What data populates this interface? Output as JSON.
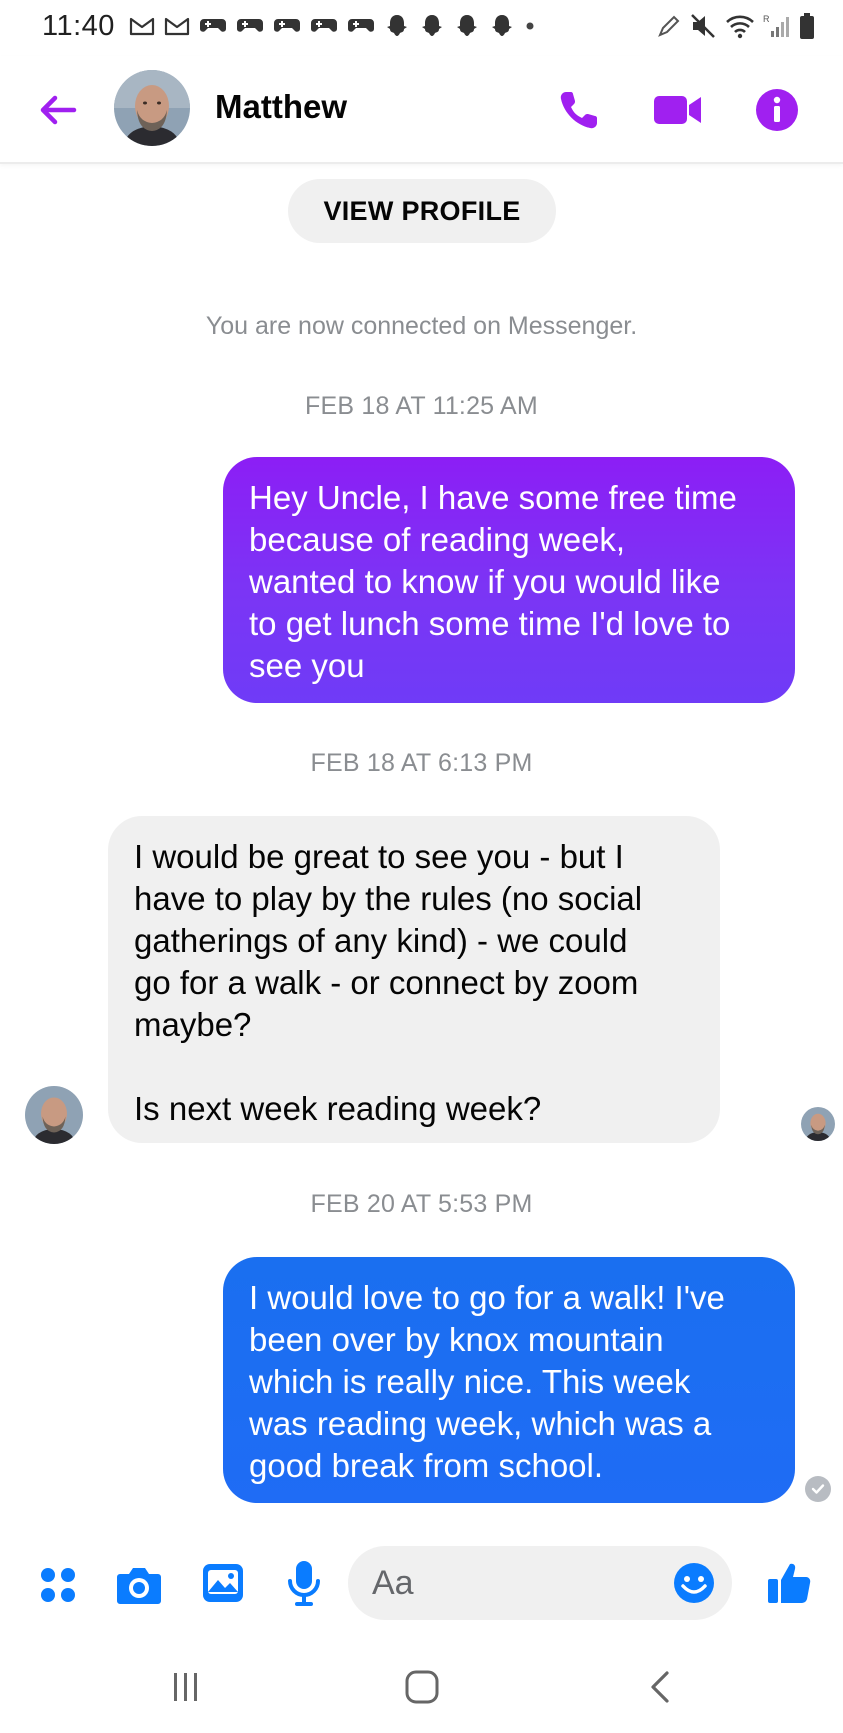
{
  "status_bar": {
    "time": "11:40",
    "notification_icons": [
      "gmail-icon",
      "gmail-icon",
      "gamepad-icon",
      "gamepad-icon",
      "gamepad-icon",
      "gamepad-icon",
      "gamepad-icon",
      "snapchat-icon",
      "snapchat-icon",
      "snapchat-icon",
      "snapchat-icon",
      "dot-icon"
    ],
    "system_icons": [
      "pen-icon",
      "mute-icon",
      "wifi-icon",
      "signal-icon",
      "battery-icon"
    ]
  },
  "header": {
    "contact_name": "Matthew",
    "actions": [
      "phone-icon",
      "video-icon",
      "info-icon"
    ],
    "accent_color": "#a020f0"
  },
  "conversation": {
    "view_profile_label": "VIEW PROFILE",
    "connected_text": "You are now connected on Messenger.",
    "timestamps": [
      "FEB 18 AT 11:25 AM",
      "FEB 18 AT 6:13 PM",
      "FEB 20 AT 5:53 PM"
    ],
    "messages": [
      {
        "direction": "outgoing",
        "lines": [
          "Hey Uncle, I have some free time",
          "because of reading week,",
          "wanted to know if you would like",
          "to get lunch some time I'd love to",
          "see you"
        ],
        "color": "#7b35f5"
      },
      {
        "direction": "incoming",
        "lines": [
          "I would be great to see you - but I",
          "have to play by the rules (no social",
          "gatherings of any kind) - we could",
          "go for a walk - or connect by zoom",
          "maybe?"
        ],
        "lines_2": [
          "Is next week reading week?"
        ],
        "color": "#f0f0f0"
      },
      {
        "direction": "outgoing",
        "lines": [
          "I would love to go for a walk! I've",
          "been over by knox mountain",
          "which is really nice. This week",
          "was reading week, which was a",
          "good break from school."
        ],
        "color": "#1f6cf5"
      }
    ]
  },
  "composer": {
    "placeholder": "Aa",
    "icons": [
      "apps-icon",
      "camera-icon",
      "gallery-icon",
      "microphone-icon",
      "emoji-icon",
      "thumbs-up-icon"
    ],
    "accent_color": "#0a7cff"
  },
  "nav_bar": {
    "buttons": [
      "recent-apps-icon",
      "home-icon",
      "back-icon"
    ]
  }
}
